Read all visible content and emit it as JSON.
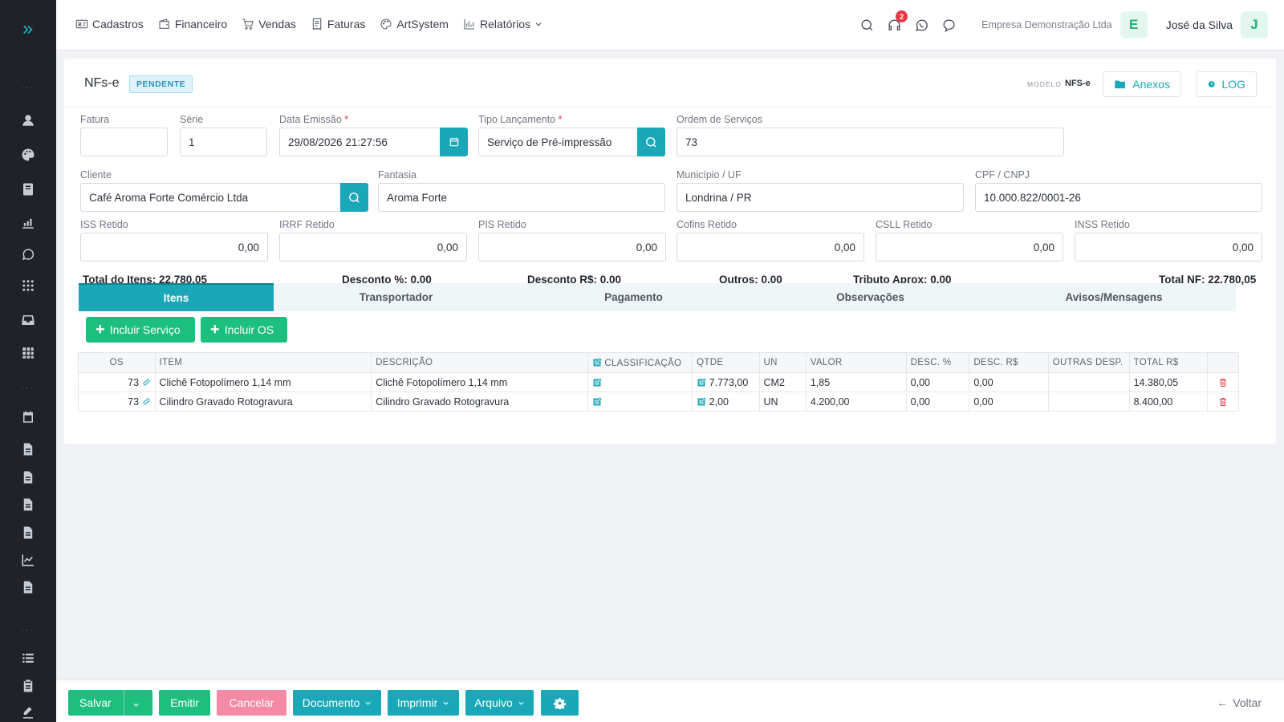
{
  "nav": {
    "items": [
      {
        "label": "Cadastros",
        "icon": "id-card-icon"
      },
      {
        "label": "Financeiro",
        "icon": "wallet-icon"
      },
      {
        "label": "Vendas",
        "icon": "cart-icon"
      },
      {
        "label": "Faturas",
        "icon": "receipt-icon"
      },
      {
        "label": "ArtSystem",
        "icon": "palette-icon"
      },
      {
        "label": "Relatórios",
        "icon": "bar-chart-icon"
      }
    ]
  },
  "topbar": {
    "notification_count": "2",
    "company": "Empresa Demonstração Ltda",
    "company_initial": "E",
    "user": "José da Silva",
    "user_initial": "J"
  },
  "header": {
    "title": "NFs-e",
    "status": "PENDENTE",
    "modelo_label": "MODELO",
    "modelo_value": "NFS-e",
    "anexos_label": "Anexos",
    "log_label": "LOG"
  },
  "form": {
    "fatura": {
      "label": "Fatura",
      "value": ""
    },
    "serie": {
      "label": "Série",
      "value": "1"
    },
    "data_emissao": {
      "label": "Data Emissão",
      "value": "29/08/2026 21:27:56"
    },
    "tipo_lancamento": {
      "label": "Tipo Lançamento",
      "value": "Serviço de Pré-impressão"
    },
    "ordem_servicos": {
      "label": "Ordem de Serviços",
      "value": "73"
    },
    "cliente": {
      "label": "Cliente",
      "value": "Café Aroma Forte Comércio Ltda"
    },
    "fantasia": {
      "label": "Fantasia",
      "value": "Aroma Forte"
    },
    "municipio": {
      "label": "Município / UF",
      "value": "Londrina / PR"
    },
    "cpf_cnpj": {
      "label": "CPF / CNPJ",
      "value": "10.000.822/0001-26"
    },
    "iss": {
      "label": "ISS Retido",
      "value": "0,00"
    },
    "irrf": {
      "label": "IRRF Retido",
      "value": "0,00"
    },
    "pis": {
      "label": "PIS Retido",
      "value": "0,00"
    },
    "cofins": {
      "label": "Cofins Retido",
      "value": "0,00"
    },
    "csll": {
      "label": "CSLL Retido",
      "value": "0,00"
    },
    "inss": {
      "label": "INSS Retido",
      "value": "0,00"
    }
  },
  "totals": {
    "itens": "Total do Itens: 22.780,05",
    "desconto_pct": "Desconto %: 0,00",
    "desconto_rs": "Desconto R$: 0,00",
    "outros": "Outros: 0,00",
    "tributo": "Tributo Aprox: 0,00",
    "total_nf": "Total NF: 22.780,05"
  },
  "tabs": [
    "Itens",
    "Transportador",
    "Pagamento",
    "Observações",
    "Avisos/Mensagens"
  ],
  "actions": {
    "incluir_servico": "Incluir Serviço",
    "incluir_os": "Incluir OS"
  },
  "table": {
    "headers": [
      "OS",
      "ITEM",
      "DESCRIÇÃO",
      "CLASSIFICAÇÃO",
      "QTDE",
      "UN",
      "VALOR",
      "DESC. %",
      "DESC. R$",
      "OUTRAS DESP.",
      "TOTAL R$"
    ],
    "rows": [
      {
        "os": "73",
        "item": "Clichê Fotopolímero 1,14 mm",
        "descricao": "Clichê Fotopolímero 1,14 mm",
        "classificacao": "",
        "qtde": "7.773,00",
        "un": "CM2",
        "valor": "1,85",
        "desc_pct": "0,00",
        "desc_rs": "0,00",
        "outras": "",
        "total": "14.380,05"
      },
      {
        "os": "73",
        "item": "Cilindro Gravado Rotogravura",
        "descricao": "Cilindro Gravado Rotogravura",
        "classificacao": "",
        "qtde": "2,00",
        "un": "UN",
        "valor": "4.200,00",
        "desc_pct": "0,00",
        "desc_rs": "0,00",
        "outras": "",
        "total": "8.400,00"
      }
    ]
  },
  "footer": {
    "salvar": "Salvar",
    "emitir": "Emitir",
    "cancelar": "Cancelar",
    "documento": "Documento",
    "imprimir": "Imprimir",
    "arquivo": "Arquivo",
    "voltar": "Voltar"
  },
  "colors": {
    "accent": "#1aa8b8",
    "success": "#1dbf7e",
    "danger": "#e53946",
    "sidebar": "#1f2229"
  }
}
